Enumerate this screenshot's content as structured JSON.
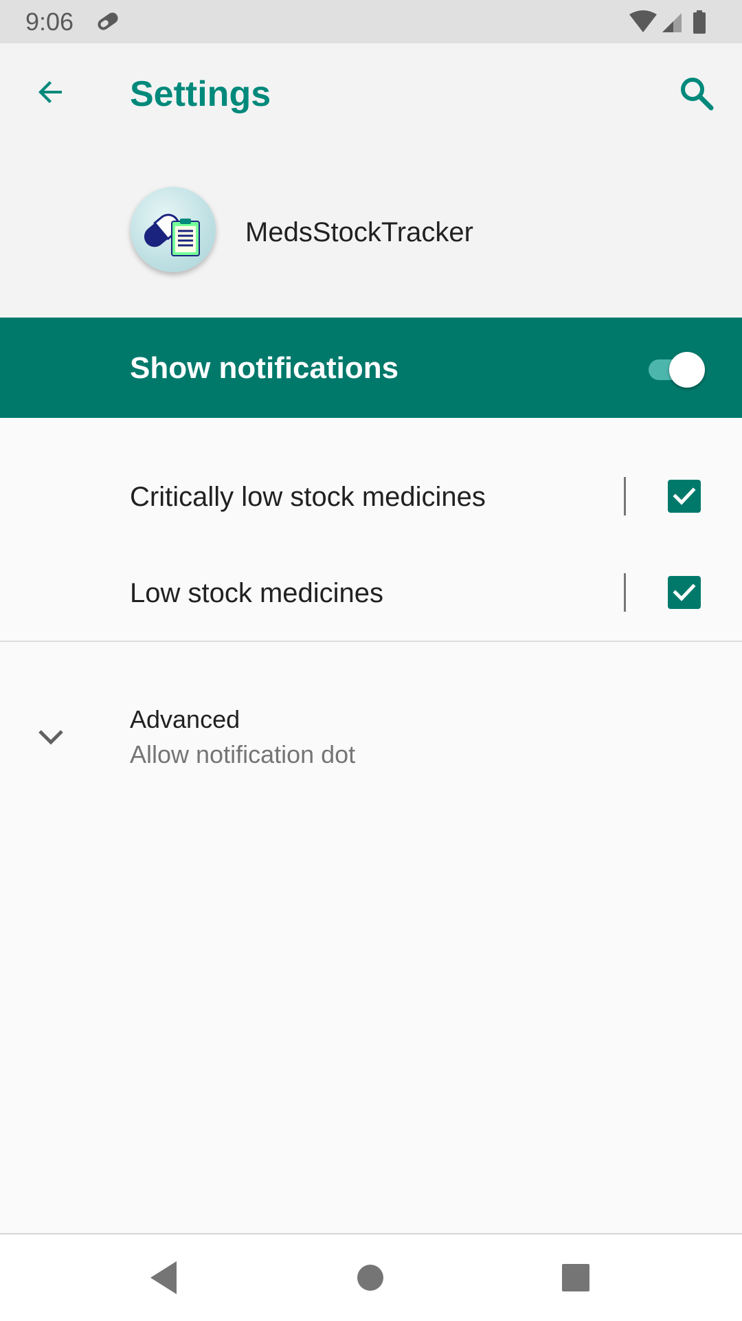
{
  "status_bar": {
    "time": "9:06",
    "icons": [
      "pill-notification-icon",
      "wifi-icon",
      "cell-signal-icon",
      "battery-icon"
    ]
  },
  "toolbar": {
    "title": "Settings",
    "back_icon": "arrow-back-icon",
    "search_icon": "search-icon"
  },
  "app": {
    "name": "MedsStockTracker",
    "icon": "meds-app-icon"
  },
  "master_toggle": {
    "label": "Show notifications",
    "enabled": true
  },
  "channels": [
    {
      "label": "Critically low stock medicines",
      "checked": true
    },
    {
      "label": "Low stock medicines",
      "checked": true
    }
  ],
  "advanced": {
    "title": "Advanced",
    "summary": "Allow notification dot",
    "icon": "chevron-down-icon"
  },
  "nav_bar": {
    "icons": [
      "nav-back-icon",
      "nav-home-icon",
      "nav-recents-icon"
    ]
  },
  "colors": {
    "accent": "#00897b",
    "accent_dark": "#00796b",
    "switch_track": "#4db6ac",
    "background": "#fafafa",
    "header_background": "#f3f3f3",
    "status_bar": "#e0e0e0"
  }
}
